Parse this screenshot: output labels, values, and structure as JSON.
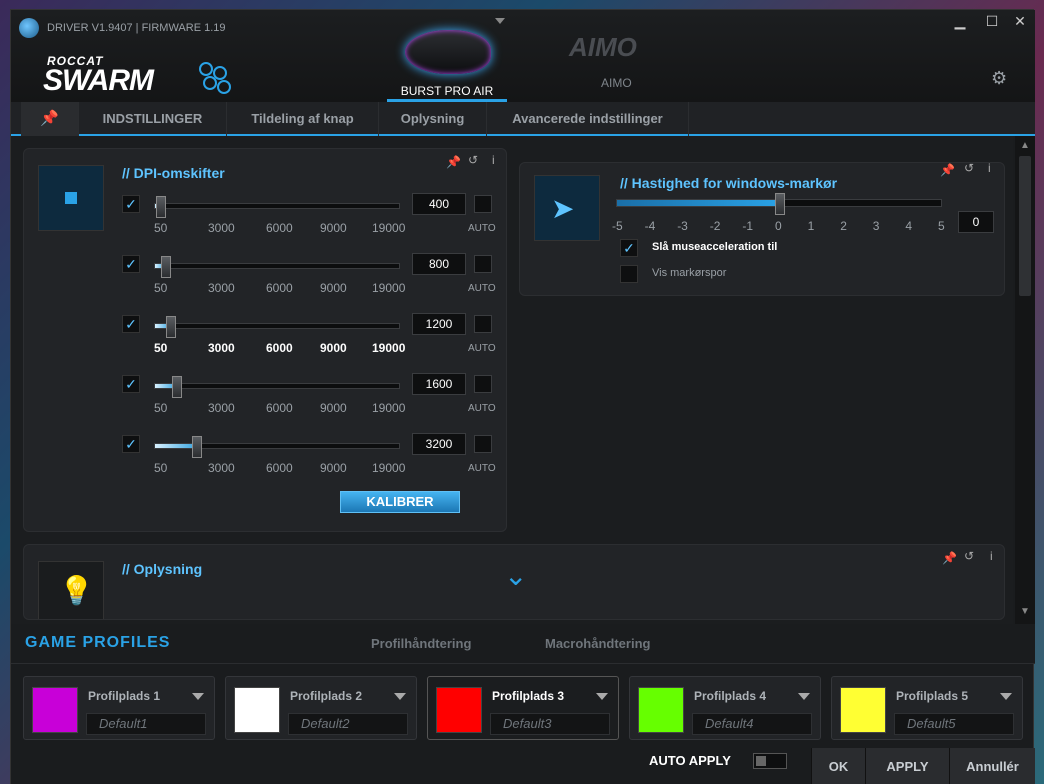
{
  "window": {
    "version": "DRIVER V1.9407 | FIRMWARE 1.19"
  },
  "logo": {
    "roccat": "ROCCAT",
    "swarm": "SWARM"
  },
  "devices": [
    {
      "label": "BURST PRO AIR"
    },
    {
      "logo": "AIMO",
      "label": "AIMO"
    }
  ],
  "nav": {
    "tabs": [
      "INDSTILLINGER",
      "Tildeling af knap",
      "Oplysning",
      "Avancerede indstillinger"
    ]
  },
  "dpi": {
    "title": "// DPI-omskifter",
    "rows": [
      {
        "value": "400",
        "level": 0.02
      },
      {
        "value": "800",
        "level": 0.042
      },
      {
        "value": "1200",
        "level": 0.063
      },
      {
        "value": "1600",
        "level": 0.084
      },
      {
        "value": "3200",
        "level": 0.168
      }
    ],
    "ticks": [
      "50",
      "3000",
      "6000",
      "9000",
      "19000"
    ],
    "auto_label": "AUTO",
    "calibrate": "KALIBRER"
  },
  "pointer": {
    "title": "// Hastighed for windows-markør",
    "ticks": [
      "-5",
      "-4",
      "-3",
      "-2",
      "-1",
      "0",
      "1",
      "2",
      "3",
      "4",
      "5"
    ],
    "value": "0",
    "accel_label": "Slå museacceleration til",
    "trail_label": "Vis markørspor"
  },
  "lighting": {
    "title": "// Oplysning"
  },
  "profiles": {
    "title": "GAME PROFILES",
    "tabs": [
      "Profilhåndtering",
      "Macrohåndtering"
    ],
    "slots": [
      {
        "name": "Profilplads 1",
        "default": "Default1",
        "color": "#c800d8"
      },
      {
        "name": "Profilplads 2",
        "default": "Default2",
        "color": "#ffffff"
      },
      {
        "name": "Profilplads 3",
        "default": "Default3",
        "color": "#ff0000"
      },
      {
        "name": "Profilplads 4",
        "default": "Default4",
        "color": "#66ff00"
      },
      {
        "name": "Profilplads 5",
        "default": "Default5",
        "color": "#ffff33"
      }
    ]
  },
  "footer": {
    "auto_apply": "AUTO APPLY",
    "ok": "OK",
    "apply": "APPLY",
    "cancel": "Annullér"
  }
}
